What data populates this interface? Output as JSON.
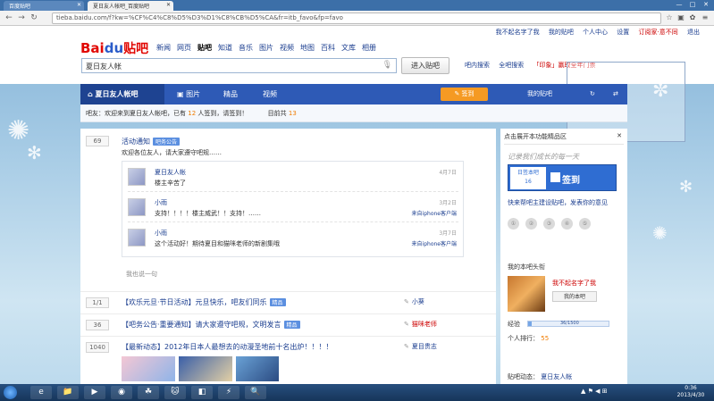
{
  "browser": {
    "tabs": [
      {
        "label": "百度贴吧",
        "active": false
      },
      {
        "label": "夏日友人帐吧_百度贴吧",
        "active": true
      }
    ],
    "url": "tieba.baidu.com/f?kw=%CF%C4%C8%D5%D3%D1%C8%CB%D5%CA&fr=itb_favo&fp=favo",
    "window_controls": [
      "—",
      "□",
      "✕"
    ]
  },
  "toplinks": {
    "user": "我不起名字了我",
    "messages": "我的贴吧",
    "personal": "个人中心",
    "settings": "设置",
    "promo": "订阅家·意不同",
    "exit": "退出"
  },
  "header": {
    "logo_bai": "Bai",
    "logo_du": "du",
    "logo_tieba": "贴吧",
    "nav": [
      "新闻",
      "网页",
      "贴吧",
      "知道",
      "音乐",
      "图片",
      "视频",
      "地图",
      "百科",
      "文库",
      "相册"
    ],
    "search_value": "夏日友人帐",
    "enter_button": "进入贴吧",
    "right_links": [
      "吧内搜索",
      "全吧搜索",
      "「印象」赢取全年门票"
    ]
  },
  "forum_nav": {
    "home": "夏日友人帐吧",
    "items": [
      "图片",
      "精品",
      "视频"
    ],
    "sign_button": "签到",
    "right": "我的贴吧"
  },
  "infobar": {
    "text1": "吧友：欢迎来到夏日友人帐吧，已有",
    "num1": "12",
    "text2": "人签到，请签到！",
    "text3": "目前共",
    "num2": "13"
  },
  "threads": {
    "pinned": {
      "replies": "69",
      "title": "活动通知",
      "tag": "吧务公告",
      "summary": "欢迎各位友人，请大家遵守吧规……",
      "replies_list": [
        {
          "name": "夏日友人帐",
          "text": "楼主辛苦了",
          "time": "4月7日",
          "source": ""
        },
        {
          "name": "小雨",
          "text": "支持！！！！楼主威武！！支持！……",
          "time": "3月2日",
          "source": "来自iphone客户端"
        },
        {
          "name": "小雨",
          "text": "这个活动好！期待夏目和猫咪老师的新剧集哦",
          "time": "3月7日",
          "source": "来自iphone客户端"
        }
      ],
      "more": "我也说一句"
    },
    "list": [
      {
        "replies": "1/1",
        "title": "【欢乐元旦·节日活动】元旦快乐，吧友们同乐",
        "tag": "精品",
        "author": "小葵",
        "red": false
      },
      {
        "replies": "36",
        "title": "【吧务公告·重要通知】请大家遵守吧规，文明发言",
        "tag": "精品",
        "author": "猫咪老师",
        "red": true
      },
      {
        "replies": "1040",
        "title": "【最新动态】2012年日本人最想去的动漫圣地前十名出炉！！！！",
        "tag": "",
        "author": "夏目贵志",
        "red": false
      }
    ]
  },
  "sidebar": {
    "head": "点击展开本功能精品区",
    "slogan": "记录我们成长的每一天",
    "sign_card_label": "日签本吧",
    "sign_card_count": "16",
    "sign_text": "签到",
    "sign_link": "快来帮吧主建设贴吧，发表你的意见",
    "icons": [
      "①",
      "②",
      "③",
      "④",
      "⑤"
    ],
    "my_title": "我的本吧头衔",
    "username": "我不起名字了我",
    "mine_button": "我的本吧",
    "exp_label": "经验",
    "exp_value": "36/1500",
    "exp_fraction": 0.024,
    "level_label": "个人排行：",
    "level_value": "55",
    "bottom_label": "贴吧动态：",
    "bottom_value": "夏日友人帐"
  },
  "taskbar": {
    "apps": [
      "📁",
      "▶",
      "◉",
      "☘",
      "🐱",
      "◧",
      "⚡",
      "🔍"
    ],
    "tray": "▲ ⚑ ◀ ⊞",
    "time": "0:36",
    "date": "2013/4/30"
  }
}
